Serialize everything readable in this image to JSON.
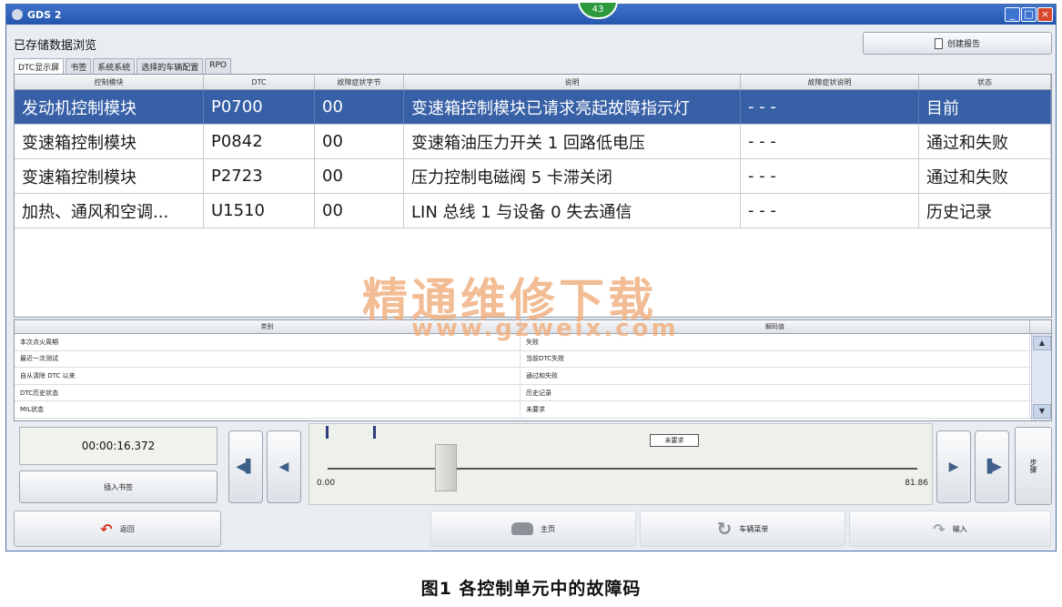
{
  "window": {
    "title": "GDS 2",
    "badge": "43"
  },
  "page": {
    "title": "已存储数据浏览",
    "create_report_label": "创建报告",
    "tabs": [
      "DTC显示屏",
      "书签",
      "系统系统",
      "选择的车辆配置",
      "RPO"
    ],
    "active_tab": "DTC显示屏"
  },
  "dtc_table": {
    "headers": [
      "控制模块",
      "DTC",
      "故障症状字节",
      "说明",
      "故障症状说明",
      "状态"
    ],
    "rows": [
      {
        "module": "发动机控制模块",
        "dtc": "P0700",
        "symptom_byte": "00",
        "description": "变速箱控制模块已请求亮起故障指示灯",
        "symptom_desc": "- - -",
        "status": "目前",
        "selected": true
      },
      {
        "module": "变速箱控制模块",
        "dtc": "P0842",
        "symptom_byte": "00",
        "description": "变速箱油压力开关 1 回路低电压",
        "symptom_desc": "- - -",
        "status": "通过和失败",
        "selected": false
      },
      {
        "module": "变速箱控制模块",
        "dtc": "P2723",
        "symptom_byte": "00",
        "description": "压力控制电磁阀 5 卡滞关闭",
        "symptom_desc": "- - -",
        "status": "通过和失败",
        "selected": false
      },
      {
        "module": "加热、通风和空调...",
        "dtc": "U1510",
        "symptom_byte": "00",
        "description": "LIN 总线 1 与设备 0 失去通信",
        "symptom_desc": "- - -",
        "status": "历史记录",
        "selected": false
      }
    ]
  },
  "watermark": {
    "text": "精通维修下载",
    "url": "www.gzweix.com"
  },
  "detail_table": {
    "headers": [
      "类别",
      "解码值"
    ],
    "rows": [
      {
        "category": "本次点火周期",
        "value": "失败"
      },
      {
        "category": "最近一次测试",
        "value": "当前DTC失败"
      },
      {
        "category": "自从清除 DTC 以来",
        "value": "通过和失败"
      },
      {
        "category": "DTC历史状态",
        "value": "历史记录"
      },
      {
        "category": "MIL状态",
        "value": "未要求"
      }
    ]
  },
  "playback": {
    "time": "00:00:16.372",
    "insert_bookmark_label": "插入书签",
    "not_requested_label": "未要求",
    "min_label": "0.00",
    "max_label": "81.86",
    "position_fraction": 0.2,
    "side_button_label": "步骤"
  },
  "bottom_bar": {
    "back_label": "返回",
    "home_label": "主页",
    "vehicle_menu_label": "车辆菜单",
    "input_label": "输入"
  },
  "caption": "图1 各控制单元中的故障码"
}
